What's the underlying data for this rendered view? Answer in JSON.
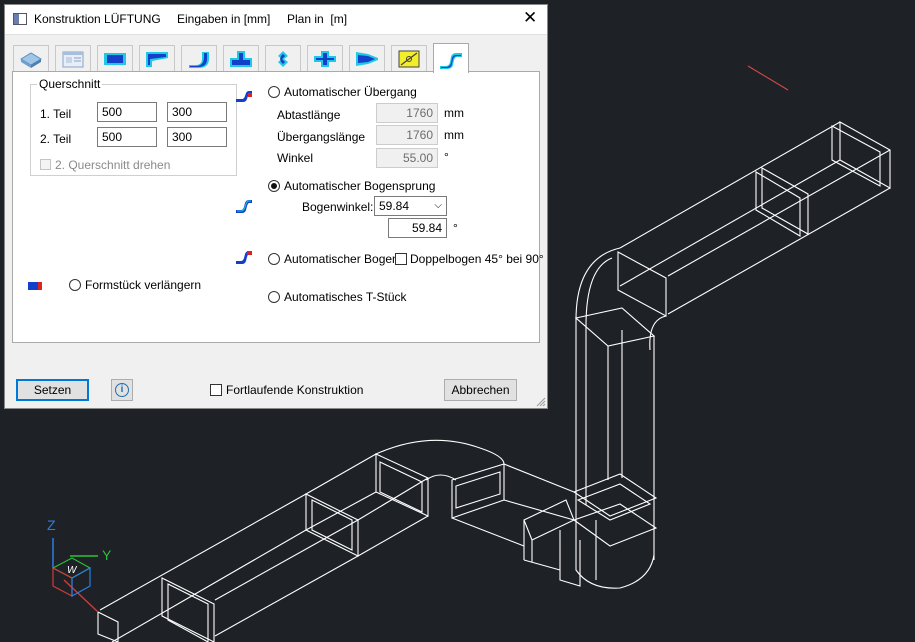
{
  "window": {
    "title": "Konstruktion LÜFTUNG",
    "units_input": "Eingaben in [mm]",
    "units_plan": "Plan in  [m]",
    "close_symbol": "✕"
  },
  "tabs": [
    {
      "icon": "duct-block-icon",
      "active": false
    },
    {
      "icon": "form-sheet-icon",
      "active": false
    },
    {
      "icon": "straight-duct-icon",
      "active": false
    },
    {
      "icon": "reducer-icon",
      "active": false
    },
    {
      "icon": "bend-icon",
      "active": false
    },
    {
      "icon": "t-piece-icon",
      "active": false
    },
    {
      "icon": "offset-icon",
      "active": false
    },
    {
      "icon": "cross-piece-icon",
      "active": false
    },
    {
      "icon": "transition-icon",
      "active": false
    },
    {
      "icon": "damper-icon",
      "active": false
    },
    {
      "icon": "auto-construction-icon",
      "active": true
    }
  ],
  "querschnitt": {
    "group_title": "Querschnitt",
    "teil1_label": "1. Teil",
    "teil1_w": "500",
    "teil1_h": "300",
    "teil2_label": "2. Teil",
    "teil2_w": "500",
    "teil2_h": "300",
    "rotate_label": "2. Querschnitt drehen"
  },
  "options": {
    "uebergang_label": "Automatischer Übergang",
    "abtast_label": "Abtastlänge",
    "abtast_value": "1760",
    "abtast_unit": "mm",
    "uebergangs_label": "Übergangslänge",
    "uebergangs_value": "1760",
    "uebergangs_unit": "mm",
    "winkel_label": "Winkel",
    "winkel_value": "55.00",
    "winkel_unit": "°",
    "bogensprung_label": "Automatischer Bogensprung",
    "bogenwinkel_label": "Bogenwinkel:",
    "bogenwinkel_selected": "59.84",
    "bogenwinkel_value": "59.84",
    "bogenwinkel_unit": "°",
    "bogen_label": "Automatischer Bogen",
    "doppelbogen_label": "Doppelbogen 45°  bei 90°",
    "tstueck_label": "Automatisches T-Stück",
    "formstueck_label": "Formstück verlängern",
    "selected": "bogensprung"
  },
  "footer": {
    "setzen_label": "Setzen",
    "info_symbol": "i",
    "fortlaufend_label": "Fortlaufende Konstruktion",
    "abbrechen_label": "Abbrechen"
  },
  "ucs": {
    "z_label": "Z",
    "y_label": "Y",
    "w_label": "W"
  },
  "colors": {
    "canvas": "#1e2126",
    "wireframe": "#ffffff",
    "accent": "#0078d7",
    "icon_blue": "#1240c8",
    "icon_cyan": "#1ec8e6"
  }
}
